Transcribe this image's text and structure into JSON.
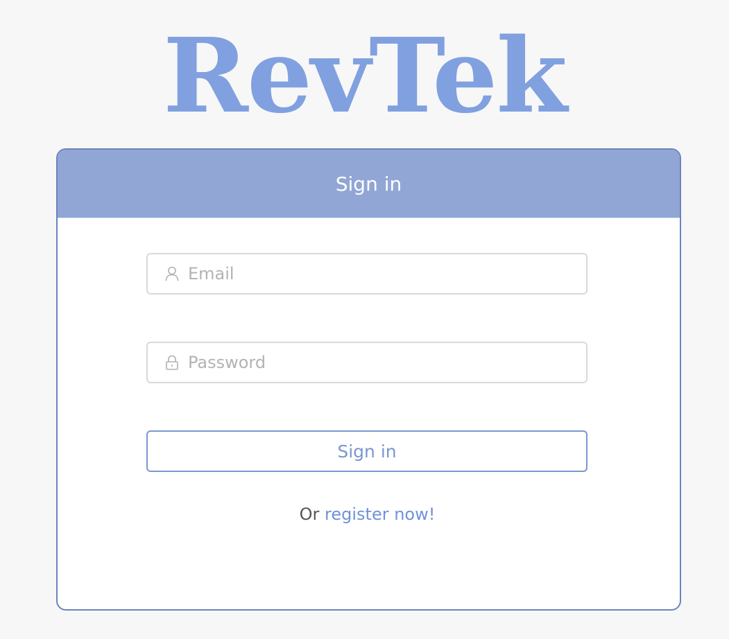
{
  "brand": {
    "logo_text": "RevTek",
    "logo_color": "#80a0e0"
  },
  "card": {
    "header_title": "Sign in",
    "header_color": "#91a6d4",
    "border_color": "#6a84bd"
  },
  "form": {
    "email": {
      "placeholder": "Email",
      "value": "",
      "icon": "user-icon"
    },
    "password": {
      "placeholder": "Password",
      "value": "",
      "icon": "lock-icon"
    },
    "submit_label": "Sign in"
  },
  "register": {
    "prefix": "Or",
    "link_text": "register now!",
    "link_color": "#6f93d6"
  }
}
